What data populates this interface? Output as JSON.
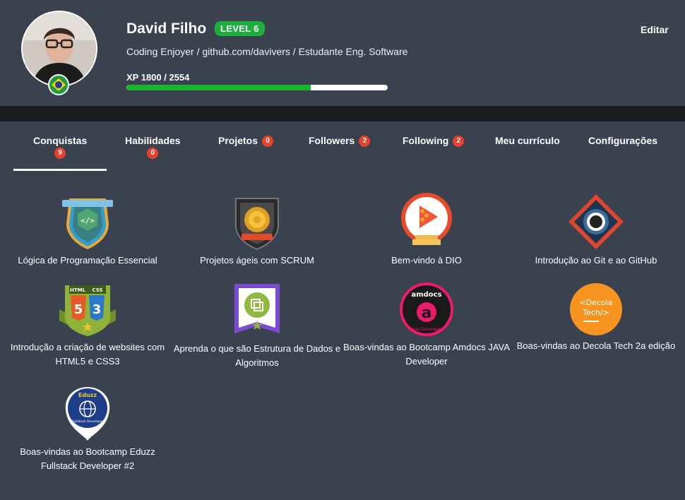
{
  "profile": {
    "name": "David Filho",
    "level": "LEVEL 6",
    "bio": "Coding Enjoyer / github.com/davivers / Estudante Eng. Software",
    "xp_label": "XP 1800 / 2554",
    "xp_current": 1800,
    "xp_total": 2554,
    "xp_fraction": 0.705,
    "edit_label": "Editar",
    "flag_icon": "brazil-flag-icon"
  },
  "colors": {
    "background": "#3a4250",
    "dark_band": "#1a1d24",
    "level_green": "#1ab03b",
    "xp_fill": "#17b52e",
    "count_badge": "#e8412c"
  },
  "tabs": [
    {
      "label": "Conquistas",
      "count": "9",
      "active": true
    },
    {
      "label": "Habilidades",
      "count": "0"
    },
    {
      "label": "Projetos",
      "count": "0"
    },
    {
      "label": "Followers",
      "count": "2"
    },
    {
      "label": "Following",
      "count": "2"
    },
    {
      "label": "Meu currículo"
    },
    {
      "label": "Configurações"
    }
  ],
  "achievements": [
    {
      "label": "Lógica de Programação Essencial",
      "icon": "code-shield-badge-icon"
    },
    {
      "label": "Projetos ágeis com SCRUM",
      "icon": "scrum-gear-badge-icon"
    },
    {
      "label": "Bem-vindo à DIO",
      "icon": "dio-welcome-badge-icon"
    },
    {
      "label": "Introdução ao Git e ao GitHub",
      "icon": "github-badge-icon"
    },
    {
      "label": "Introdução a criação de websites com HTML5 e CSS3",
      "icon": "html-css-badge-icon",
      "html_text": "HTML",
      "css_text": "CSS"
    },
    {
      "label": "Aprenda o que são Estrutura de Dados e Algoritmos",
      "icon": "data-structures-badge-icon"
    },
    {
      "label": "Boas-vindas ao Bootcamp Amdocs JAVA Developer",
      "icon": "amdocs-badge-icon",
      "top_text": "amdocs",
      "bottom_text": "Java Developer"
    },
    {
      "label": "Boas-vindas ao Decola Tech 2a edição",
      "icon": "decola-tech-badge-icon",
      "line1": "<Decola",
      "line2": "Tech/>"
    },
    {
      "label": "Boas-vindas ao Bootcamp Eduzz Fullstack Developer #2",
      "icon": "eduzz-badge-icon",
      "top_text": "Eduzz",
      "bottom_text": "Fullstack Developer"
    }
  ]
}
